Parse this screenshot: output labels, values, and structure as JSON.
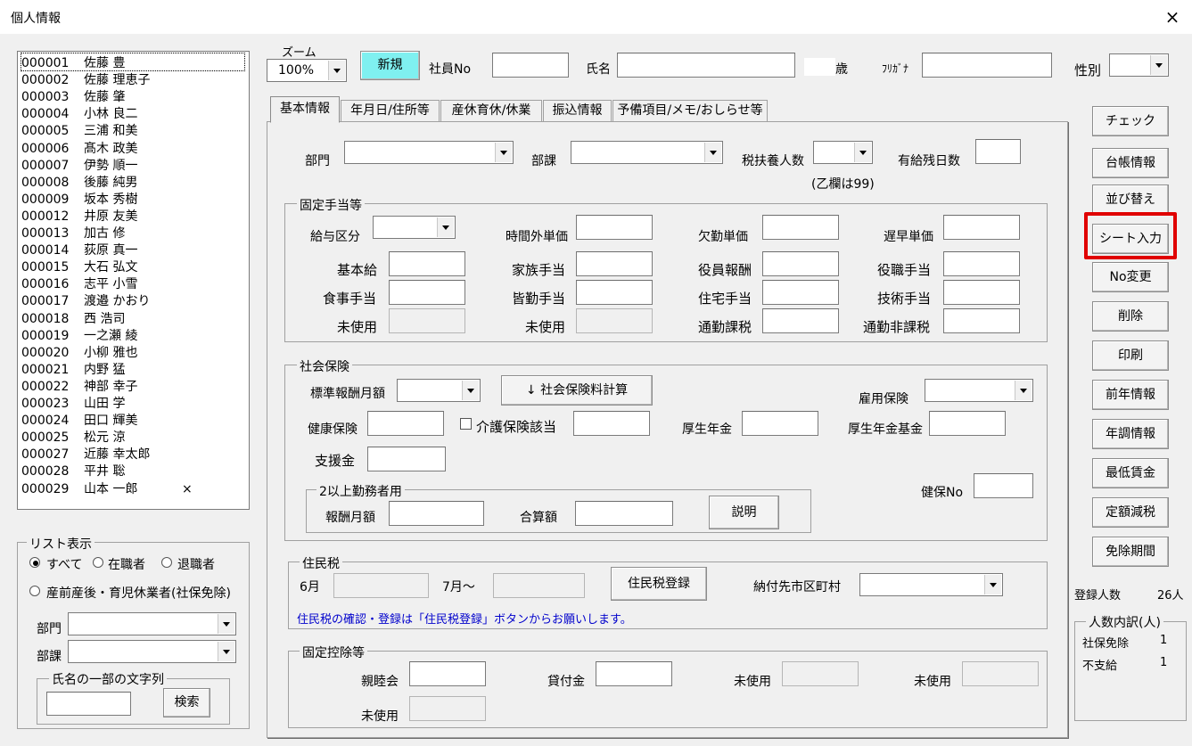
{
  "window": {
    "title": "個人情報",
    "close": "×"
  },
  "employees": [
    {
      "code": "000001",
      "name": "佐藤 豊",
      "mark": ""
    },
    {
      "code": "000002",
      "name": "佐藤 理恵子",
      "mark": ""
    },
    {
      "code": "000003",
      "name": "佐藤 肇",
      "mark": ""
    },
    {
      "code": "000004",
      "name": "小林 良二",
      "mark": ""
    },
    {
      "code": "000005",
      "name": "三浦 和美",
      "mark": ""
    },
    {
      "code": "000006",
      "name": "髙木 政美",
      "mark": ""
    },
    {
      "code": "000007",
      "name": "伊勢 順一",
      "mark": ""
    },
    {
      "code": "000008",
      "name": "後藤 純男",
      "mark": ""
    },
    {
      "code": "000009",
      "name": "坂本 秀樹",
      "mark": ""
    },
    {
      "code": "000012",
      "name": "井原 友美",
      "mark": ""
    },
    {
      "code": "000013",
      "name": "加古 修",
      "mark": ""
    },
    {
      "code": "000014",
      "name": "荻原 真一",
      "mark": ""
    },
    {
      "code": "000015",
      "name": "大石 弘文",
      "mark": ""
    },
    {
      "code": "000016",
      "name": "志平 小雪",
      "mark": ""
    },
    {
      "code": "000017",
      "name": "渡邉 かおり",
      "mark": ""
    },
    {
      "code": "000018",
      "name": "西 浩司",
      "mark": ""
    },
    {
      "code": "000019",
      "name": "一之瀬 綾",
      "mark": ""
    },
    {
      "code": "000020",
      "name": "小柳 雅也",
      "mark": ""
    },
    {
      "code": "000021",
      "name": "内野 猛",
      "mark": ""
    },
    {
      "code": "000022",
      "name": "神部 幸子",
      "mark": ""
    },
    {
      "code": "000023",
      "name": "山田 学",
      "mark": ""
    },
    {
      "code": "000024",
      "name": "田口 輝美",
      "mark": ""
    },
    {
      "code": "000025",
      "name": "松元 涼",
      "mark": ""
    },
    {
      "code": "000027",
      "name": "近藤 幸太郎",
      "mark": ""
    },
    {
      "code": "000028",
      "name": "平井 聡",
      "mark": ""
    },
    {
      "code": "000029",
      "name": "山本 一郎",
      "mark": "×"
    }
  ],
  "list_display": {
    "title": "リスト表示",
    "all": "すべて",
    "active": "在職者",
    "retired": "退職者",
    "leave": "産前産後・育児休業者(社保免除)",
    "dept": "部門",
    "section": "部課",
    "name_search_title": "氏名の一部の文字列",
    "search_button": "検索"
  },
  "header": {
    "zoom_label": "ズーム",
    "zoom_value": "100%",
    "new_button": "新規",
    "emp_no": "社員No",
    "name": "氏名",
    "age_unit": "歳",
    "furigana": "ﾌﾘｶﾞﾅ",
    "gender": "性別"
  },
  "tabs": [
    "基本情報",
    "年月日/住所等",
    "産休育休/休業",
    "振込情報",
    "予備項目/メモ/おしらせ等"
  ],
  "basic": {
    "dept": "部門",
    "section": "部課",
    "dependents": "税扶養人数",
    "dependents_note": "(乙欄は99)",
    "paid_leave": "有給残日数"
  },
  "allowances": {
    "title": "固定手当等",
    "pay_type": "給与区分",
    "overtime": "時間外単価",
    "absence": "欠勤単価",
    "late": "遅早単価",
    "base": "基本給",
    "family": "家族手当",
    "officer": "役員報酬",
    "position": "役職手当",
    "meal": "食事手当",
    "perfect": "皆勤手当",
    "housing": "住宅手当",
    "skill": "技術手当",
    "unused1": "未使用",
    "unused2": "未使用",
    "commute_tax": "通勤課税",
    "commute_free": "通勤非課税"
  },
  "social": {
    "title": "社会保険",
    "std_monthly": "標準報酬月額",
    "calc_button": "↓ 社会保険料計算",
    "employment": "雇用保険",
    "health": "健康保険",
    "care": "介護保険該当",
    "pension": "厚生年金",
    "pension_fund": "厚生年金基金",
    "support": "支援金",
    "multi_title": "2以上勤務者用",
    "multi_pay": "報酬月額",
    "multi_total": "合算額",
    "explain_button": "説明",
    "health_no": "健保No"
  },
  "resident": {
    "title": "住民税",
    "june": "6月",
    "july": "7月～",
    "register_button": "住民税登録",
    "city": "納付先市区町村",
    "note": "住民税の確認・登録は「住民税登録」ボタンからお願いします。"
  },
  "deductions": {
    "title": "固定控除等",
    "social_club": "親睦会",
    "loan": "貸付金",
    "unused1": "未使用",
    "unused2": "未使用",
    "unused3": "未使用"
  },
  "side_buttons": [
    "チェック",
    "台帳情報",
    "並び替え",
    "シート入力",
    "No変更",
    "削除",
    "印刷",
    "前年情報",
    "年調情報",
    "最低賃金",
    "定額減税",
    "免除期間"
  ],
  "stats": {
    "registered_label": "登録人数",
    "registered_value": "26人",
    "breakdown_title": "人数内訳(人)",
    "exempt_label": "社保免除",
    "exempt_value": "1",
    "unpaid_label": "不支給",
    "unpaid_value": "1"
  },
  "colors": {
    "new_button": "#7ff0f0",
    "highlight": "#e00000",
    "note_text": "#0000cc"
  }
}
